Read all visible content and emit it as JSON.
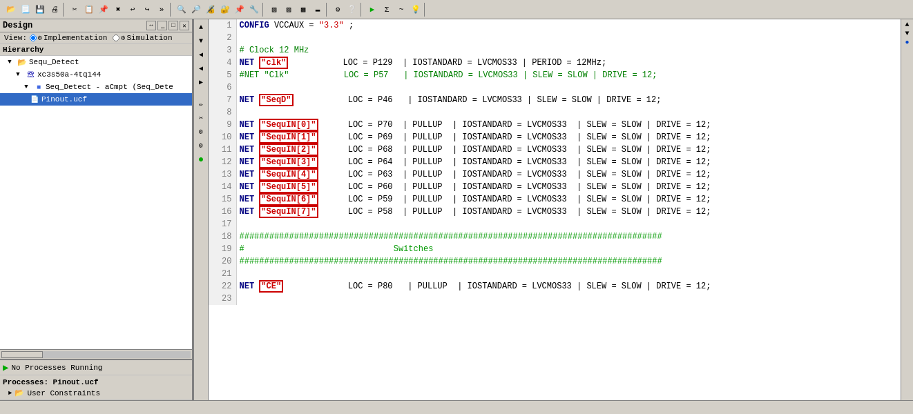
{
  "app": {
    "title": "Design",
    "toolbar_groups": [
      {
        "buttons": [
          "📁",
          "🆕",
          "💾",
          "🖨️",
          "✂️",
          "📋",
          "📄",
          "↩",
          "↪",
          "▶▶",
          "▶"
        ]
      },
      {
        "buttons": [
          "🔍",
          "🔎",
          "🔬",
          "⚙️",
          "🛠️",
          "▶",
          "Σ",
          "~",
          "💡"
        ]
      }
    ]
  },
  "left_panel": {
    "title": "Design",
    "view_label": "View:",
    "view_options": [
      "Implementation",
      "Simulation"
    ],
    "view_selected": "Implementation",
    "hierarchy_label": "Hierarchy",
    "tree_items": [
      {
        "id": "sequ_detect",
        "label": "Sequ_Detect",
        "indent": 1,
        "type": "folder",
        "expanded": true
      },
      {
        "id": "xc3s50a",
        "label": "xc3s50a-4tq144",
        "indent": 2,
        "type": "chip",
        "expanded": true
      },
      {
        "id": "seq_detect_acmpt",
        "label": "Seq_Detect - aCmpt (Seq_Dete",
        "indent": 3,
        "type": "component",
        "expanded": true
      },
      {
        "id": "pinout_ucf",
        "label": "Pinout.ucf",
        "indent": 4,
        "type": "doc",
        "selected": true
      }
    ]
  },
  "process_panel": {
    "status_label": "No Processes Running",
    "section_title": "Processes: Pinout.ucf",
    "tree_items": [
      {
        "label": "User Constraints",
        "indent": 1,
        "type": "folder",
        "expanded": false
      }
    ]
  },
  "mid_toolbar": {
    "buttons": [
      "▲",
      "▼",
      "◀",
      "◀",
      "▶",
      "✎",
      "✂",
      "⚙",
      "⚙",
      "●"
    ]
  },
  "code": {
    "lines": [
      {
        "num": 1,
        "content": "CONFIG VCCAUX = \"3.3\" ;",
        "tokens": [
          {
            "type": "kw",
            "text": "CONFIG"
          },
          {
            "type": "norm",
            "text": " VCCAUX = "
          },
          {
            "type": "str",
            "text": "\"3.3\""
          },
          {
            "type": "norm",
            "text": " ;"
          }
        ]
      },
      {
        "num": 2,
        "content": "",
        "tokens": []
      },
      {
        "num": 3,
        "content": "# Clock 12 MHz",
        "tokens": [
          {
            "type": "comment",
            "text": "# Clock 12 MHz"
          }
        ]
      },
      {
        "num": 4,
        "content": "NET \"clk\"           LOC = P129  | IOSTANDARD = LVCMOS33 | PERIOD = 12MHz;",
        "tokens": [
          {
            "type": "kw",
            "text": "NET"
          },
          {
            "type": "norm",
            "text": " "
          },
          {
            "type": "highlight",
            "text": "\"clk\""
          },
          {
            "type": "norm",
            "text": "           LOC = P129  | IOSTANDARD = LVCMOS33 | PERIOD = 12MHz;"
          }
        ]
      },
      {
        "num": 5,
        "content": "#NET \"Clk\"           LOC = P57   | IOSTANDARD = LVCMOS33 | SLEW = SLOW | DRIVE = 12;",
        "tokens": [
          {
            "type": "comment",
            "text": "#NET \"Clk\"           LOC = P57   | IOSTANDARD = LVCMOS33 | SLEW = SLOW | DRIVE = 12;"
          }
        ]
      },
      {
        "num": 6,
        "content": "",
        "tokens": []
      },
      {
        "num": 7,
        "content": "NET \"SeqD\"           LOC = P46   | IOSTANDARD = LVCMOS33 | SLEW = SLOW | DRIVE = 12;",
        "tokens": [
          {
            "type": "kw",
            "text": "NET"
          },
          {
            "type": "norm",
            "text": " "
          },
          {
            "type": "highlight",
            "text": "\"SeqD\""
          },
          {
            "type": "norm",
            "text": "           LOC = P46   | IOSTANDARD = LVCMOS33 | SLEW = SLOW | DRIVE = 12;"
          }
        ]
      },
      {
        "num": 8,
        "content": "",
        "tokens": []
      },
      {
        "num": 9,
        "content": "NET \"SequIN[0]\"      LOC = P70  | PULLUP  | IOSTANDARD = LVCMOS33  | SLEW = SLOW | DRIVE = 12;",
        "tokens": [
          {
            "type": "kw",
            "text": "NET"
          },
          {
            "type": "norm",
            "text": " "
          },
          {
            "type": "highlight",
            "text": "\"SequIN[0]\""
          },
          {
            "type": "norm",
            "text": "      LOC = P70  | PULLUP  | IOSTANDARD = LVCMOS33  | SLEW = SLOW | DRIVE = 12;"
          }
        ]
      },
      {
        "num": 10,
        "content": "NET \"SequIN[1]\"      LOC = P69  | PULLUP  | IOSTANDARD = LVCMOS33  | SLEW = SLOW | DRIVE = 12;",
        "tokens": [
          {
            "type": "kw",
            "text": "NET"
          },
          {
            "type": "norm",
            "text": " "
          },
          {
            "type": "highlight",
            "text": "\"SequIN[1]\""
          },
          {
            "type": "norm",
            "text": "      LOC = P69  | PULLUP  | IOSTANDARD = LVCMOS33  | SLEW = SLOW | DRIVE = 12;"
          }
        ]
      },
      {
        "num": 11,
        "content": "NET \"SequIN[2]\"      LOC = P68  | PULLUP  | IOSTANDARD = LVCMOS33  | SLEW = SLOW | DRIVE = 12;",
        "tokens": [
          {
            "type": "kw",
            "text": "NET"
          },
          {
            "type": "norm",
            "text": " "
          },
          {
            "type": "highlight",
            "text": "\"SequIN[2]\""
          },
          {
            "type": "norm",
            "text": "      LOC = P68  | PULLUP  | IOSTANDARD = LVCMOS33  | SLEW = SLOW | DRIVE = 12;"
          }
        ]
      },
      {
        "num": 12,
        "content": "NET \"SequIN[3]\"      LOC = P64  | PULLUP  | IOSTANDARD = LVCMOS33  | SLEW = SLOW | DRIVE = 12;",
        "tokens": [
          {
            "type": "kw",
            "text": "NET"
          },
          {
            "type": "norm",
            "text": " "
          },
          {
            "type": "highlight",
            "text": "\"SequIN[3]\""
          },
          {
            "type": "norm",
            "text": "      LOC = P64  | PULLUP  | IOSTANDARD = LVCMOS33  | SLEW = SLOW | DRIVE = 12;"
          }
        ]
      },
      {
        "num": 13,
        "content": "NET \"SequIN[4]\"      LOC = P63  | PULLUP  | IOSTANDARD = LVCMOS33  | SLEW = SLOW | DRIVE = 12;",
        "tokens": [
          {
            "type": "kw",
            "text": "NET"
          },
          {
            "type": "norm",
            "text": " "
          },
          {
            "type": "highlight",
            "text": "\"SequIN[4]\""
          },
          {
            "type": "norm",
            "text": "      LOC = P63  | PULLUP  | IOSTANDARD = LVCMOS33  | SLEW = SLOW | DRIVE = 12;"
          }
        ]
      },
      {
        "num": 14,
        "content": "NET \"SequIN[5]\"      LOC = P60  | PULLUP  | IOSTANDARD = LVCMOS33  | SLEW = SLOW | DRIVE = 12;",
        "tokens": [
          {
            "type": "kw",
            "text": "NET"
          },
          {
            "type": "norm",
            "text": " "
          },
          {
            "type": "highlight",
            "text": "\"SequIN[5]\""
          },
          {
            "type": "norm",
            "text": "      LOC = P60  | PULLUP  | IOSTANDARD = LVCMOS33  | SLEW = SLOW | DRIVE = 12;"
          }
        ]
      },
      {
        "num": 15,
        "content": "NET \"SequIN[6]\"      LOC = P59  | PULLUP  | IOSTANDARD = LVCMOS33  | SLEW = SLOW | DRIVE = 12;",
        "tokens": [
          {
            "type": "kw",
            "text": "NET"
          },
          {
            "type": "norm",
            "text": " "
          },
          {
            "type": "highlight",
            "text": "\"SequIN[6]\""
          },
          {
            "type": "norm",
            "text": "      LOC = P59  | PULLUP  | IOSTANDARD = LVCMOS33  | SLEW = SLOW | DRIVE = 12;"
          }
        ]
      },
      {
        "num": 16,
        "content": "NET \"SequIN[7]\"      LOC = P58  | PULLUP  | IOSTANDARD = LVCMOS33  | SLEW = SLOW | DRIVE = 12;",
        "tokens": [
          {
            "type": "kw",
            "text": "NET"
          },
          {
            "type": "norm",
            "text": " "
          },
          {
            "type": "highlight",
            "text": "\"SequIN[7]\""
          },
          {
            "type": "norm",
            "text": "      LOC = P58  | PULLUP  | IOSTANDARD = LVCMOS33  | SLEW = SLOW | DRIVE = 12;"
          }
        ]
      },
      {
        "num": 17,
        "content": "",
        "tokens": []
      },
      {
        "num": 18,
        "content": "#####################################################################################",
        "tokens": [
          {
            "type": "hash",
            "text": "#####################################################################################"
          }
        ]
      },
      {
        "num": 19,
        "content": "#                              Switches",
        "tokens": [
          {
            "type": "hash",
            "text": "#                              Switches"
          }
        ]
      },
      {
        "num": 20,
        "content": "#####################################################################################",
        "tokens": [
          {
            "type": "hash",
            "text": "#####################################################################################"
          }
        ]
      },
      {
        "num": 21,
        "content": "",
        "tokens": []
      },
      {
        "num": 22,
        "content": "NET \"CE\"             LOC = P80   | PULLUP  | IOSTANDARD = LVCMOS33 | SLEW = SLOW | DRIVE = 12;",
        "tokens": [
          {
            "type": "kw",
            "text": "NET"
          },
          {
            "type": "norm",
            "text": " "
          },
          {
            "type": "highlight",
            "text": "\"CE\""
          },
          {
            "type": "norm",
            "text": "             LOC = P80   | PULLUP  | IOSTANDARD = LVCMOS33 | SLEW = SLOW | DRIVE = 12;"
          }
        ]
      },
      {
        "num": 23,
        "content": "",
        "tokens": []
      }
    ]
  },
  "status_bar": {
    "text": ""
  },
  "colors": {
    "keyword": "#000080",
    "string_highlighted": "#cc0000",
    "comment": "#008000",
    "hash_line": "#009900",
    "normal": "#000000",
    "selected_bg": "#316ac5",
    "selected_fg": "#ffffff"
  }
}
